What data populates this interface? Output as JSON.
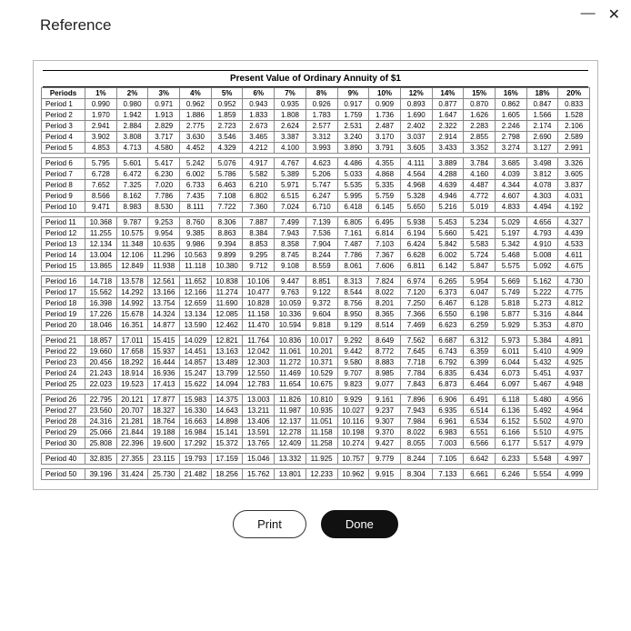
{
  "window": {
    "title": "Reference",
    "minimize": "—",
    "close": "✕"
  },
  "buttons": {
    "print": "Print",
    "done": "Done"
  },
  "table": {
    "caption": "Present Value of Ordinary Annuity of $1",
    "corner": "Periods",
    "rates": [
      "1%",
      "2%",
      "3%",
      "4%",
      "5%",
      "6%",
      "7%",
      "8%",
      "9%",
      "10%",
      "12%",
      "14%",
      "15%",
      "16%",
      "18%",
      "20%"
    ],
    "groups": [
      [
        {
          "label": "Period 1",
          "vals": [
            "0.990",
            "0.980",
            "0.971",
            "0.962",
            "0.952",
            "0.943",
            "0.935",
            "0.926",
            "0.917",
            "0.909",
            "0.893",
            "0.877",
            "0.870",
            "0.862",
            "0.847",
            "0.833"
          ]
        },
        {
          "label": "Period 2",
          "vals": [
            "1.970",
            "1.942",
            "1.913",
            "1.886",
            "1.859",
            "1.833",
            "1.808",
            "1.783",
            "1.759",
            "1.736",
            "1.690",
            "1.647",
            "1.626",
            "1.605",
            "1.566",
            "1.528"
          ]
        },
        {
          "label": "Period 3",
          "vals": [
            "2.941",
            "2.884",
            "2.829",
            "2.775",
            "2.723",
            "2.673",
            "2.624",
            "2.577",
            "2.531",
            "2.487",
            "2.402",
            "2.322",
            "2.283",
            "2.246",
            "2.174",
            "2.106"
          ]
        },
        {
          "label": "Period 4",
          "vals": [
            "3.902",
            "3.808",
            "3.717",
            "3.630",
            "3.546",
            "3.465",
            "3.387",
            "3.312",
            "3.240",
            "3.170",
            "3.037",
            "2.914",
            "2.855",
            "2.798",
            "2.690",
            "2.589"
          ]
        },
        {
          "label": "Period 5",
          "vals": [
            "4.853",
            "4.713",
            "4.580",
            "4.452",
            "4.329",
            "4.212",
            "4.100",
            "3.993",
            "3.890",
            "3.791",
            "3.605",
            "3.433",
            "3.352",
            "3.274",
            "3.127",
            "2.991"
          ]
        }
      ],
      [
        {
          "label": "Period 6",
          "vals": [
            "5.795",
            "5.601",
            "5.417",
            "5.242",
            "5.076",
            "4.917",
            "4.767",
            "4.623",
            "4.486",
            "4.355",
            "4.111",
            "3.889",
            "3.784",
            "3.685",
            "3.498",
            "3.326"
          ]
        },
        {
          "label": "Period 7",
          "vals": [
            "6.728",
            "6.472",
            "6.230",
            "6.002",
            "5.786",
            "5.582",
            "5.389",
            "5.206",
            "5.033",
            "4.868",
            "4.564",
            "4.288",
            "4.160",
            "4.039",
            "3.812",
            "3.605"
          ]
        },
        {
          "label": "Period 8",
          "vals": [
            "7.652",
            "7.325",
            "7.020",
            "6.733",
            "6.463",
            "6.210",
            "5.971",
            "5.747",
            "5.535",
            "5.335",
            "4.968",
            "4.639",
            "4.487",
            "4.344",
            "4.078",
            "3.837"
          ]
        },
        {
          "label": "Period 9",
          "vals": [
            "8.566",
            "8.162",
            "7.786",
            "7.435",
            "7.108",
            "6.802",
            "6.515",
            "6.247",
            "5.995",
            "5.759",
            "5.328",
            "4.946",
            "4.772",
            "4.607",
            "4.303",
            "4.031"
          ]
        },
        {
          "label": "Period 10",
          "vals": [
            "9.471",
            "8.983",
            "8.530",
            "8.111",
            "7.722",
            "7.360",
            "7.024",
            "6.710",
            "6.418",
            "6.145",
            "5.650",
            "5.216",
            "5.019",
            "4.833",
            "4.494",
            "4.192"
          ]
        }
      ],
      [
        {
          "label": "Period 11",
          "vals": [
            "10.368",
            "9.787",
            "9.253",
            "8.760",
            "8.306",
            "7.887",
            "7.499",
            "7.139",
            "6.805",
            "6.495",
            "5.938",
            "5.453",
            "5.234",
            "5.029",
            "4.656",
            "4.327"
          ]
        },
        {
          "label": "Period 12",
          "vals": [
            "11.255",
            "10.575",
            "9.954",
            "9.385",
            "8.863",
            "8.384",
            "7.943",
            "7.536",
            "7.161",
            "6.814",
            "6.194",
            "5.660",
            "5.421",
            "5.197",
            "4.793",
            "4.439"
          ]
        },
        {
          "label": "Period 13",
          "vals": [
            "12.134",
            "11.348",
            "10.635",
            "9.986",
            "9.394",
            "8.853",
            "8.358",
            "7.904",
            "7.487",
            "7.103",
            "6.424",
            "5.842",
            "5.583",
            "5.342",
            "4.910",
            "4.533"
          ]
        },
        {
          "label": "Period 14",
          "vals": [
            "13.004",
            "12.106",
            "11.296",
            "10.563",
            "9.899",
            "9.295",
            "8.745",
            "8.244",
            "7.786",
            "7.367",
            "6.628",
            "6.002",
            "5.724",
            "5.468",
            "5.008",
            "4.611"
          ]
        },
        {
          "label": "Period 15",
          "vals": [
            "13.865",
            "12.849",
            "11.938",
            "11.118",
            "10.380",
            "9.712",
            "9.108",
            "8.559",
            "8.061",
            "7.606",
            "6.811",
            "6.142",
            "5.847",
            "5.575",
            "5.092",
            "4.675"
          ]
        }
      ],
      [
        {
          "label": "Period 16",
          "vals": [
            "14.718",
            "13.578",
            "12.561",
            "11.652",
            "10.838",
            "10.106",
            "9.447",
            "8.851",
            "8.313",
            "7.824",
            "6.974",
            "6.265",
            "5.954",
            "5.669",
            "5.162",
            "4.730"
          ]
        },
        {
          "label": "Period 17",
          "vals": [
            "15.562",
            "14.292",
            "13.166",
            "12.166",
            "11.274",
            "10.477",
            "9.763",
            "9.122",
            "8.544",
            "8.022",
            "7.120",
            "6.373",
            "6.047",
            "5.749",
            "5.222",
            "4.775"
          ]
        },
        {
          "label": "Period 18",
          "vals": [
            "16.398",
            "14.992",
            "13.754",
            "12.659",
            "11.690",
            "10.828",
            "10.059",
            "9.372",
            "8.756",
            "8.201",
            "7.250",
            "6.467",
            "6.128",
            "5.818",
            "5.273",
            "4.812"
          ]
        },
        {
          "label": "Period 19",
          "vals": [
            "17.226",
            "15.678",
            "14.324",
            "13.134",
            "12.085",
            "11.158",
            "10.336",
            "9.604",
            "8.950",
            "8.365",
            "7.366",
            "6.550",
            "6.198",
            "5.877",
            "5.316",
            "4.844"
          ]
        },
        {
          "label": "Period 20",
          "vals": [
            "18.046",
            "16.351",
            "14.877",
            "13.590",
            "12.462",
            "11.470",
            "10.594",
            "9.818",
            "9.129",
            "8.514",
            "7.469",
            "6.623",
            "6.259",
            "5.929",
            "5.353",
            "4.870"
          ]
        }
      ],
      [
        {
          "label": "Period 21",
          "vals": [
            "18.857",
            "17.011",
            "15.415",
            "14.029",
            "12.821",
            "11.764",
            "10.836",
            "10.017",
            "9.292",
            "8.649",
            "7.562",
            "6.687",
            "6.312",
            "5.973",
            "5.384",
            "4.891"
          ]
        },
        {
          "label": "Period 22",
          "vals": [
            "19.660",
            "17.658",
            "15.937",
            "14.451",
            "13.163",
            "12.042",
            "11.061",
            "10.201",
            "9.442",
            "8.772",
            "7.645",
            "6.743",
            "6.359",
            "6.011",
            "5.410",
            "4.909"
          ]
        },
        {
          "label": "Period 23",
          "vals": [
            "20.456",
            "18.292",
            "16.444",
            "14.857",
            "13.489",
            "12.303",
            "11.272",
            "10.371",
            "9.580",
            "8.883",
            "7.718",
            "6.792",
            "6.399",
            "6.044",
            "5.432",
            "4.925"
          ]
        },
        {
          "label": "Period 24",
          "vals": [
            "21.243",
            "18.914",
            "16.936",
            "15.247",
            "13.799",
            "12.550",
            "11.469",
            "10.529",
            "9.707",
            "8.985",
            "7.784",
            "6.835",
            "6.434",
            "6.073",
            "5.451",
            "4.937"
          ]
        },
        {
          "label": "Period 25",
          "vals": [
            "22.023",
            "19.523",
            "17.413",
            "15.622",
            "14.094",
            "12.783",
            "11.654",
            "10.675",
            "9.823",
            "9.077",
            "7.843",
            "6.873",
            "6.464",
            "6.097",
            "5.467",
            "4.948"
          ]
        }
      ],
      [
        {
          "label": "Period 26",
          "vals": [
            "22.795",
            "20.121",
            "17.877",
            "15.983",
            "14.375",
            "13.003",
            "11.826",
            "10.810",
            "9.929",
            "9.161",
            "7.896",
            "6.906",
            "6.491",
            "6.118",
            "5.480",
            "4.956"
          ]
        },
        {
          "label": "Period 27",
          "vals": [
            "23.560",
            "20.707",
            "18.327",
            "16.330",
            "14.643",
            "13.211",
            "11.987",
            "10.935",
            "10.027",
            "9.237",
            "7.943",
            "6.935",
            "6.514",
            "6.136",
            "5.492",
            "4.964"
          ]
        },
        {
          "label": "Period 28",
          "vals": [
            "24.316",
            "21.281",
            "18.764",
            "16.663",
            "14.898",
            "13.406",
            "12.137",
            "11.051",
            "10.116",
            "9.307",
            "7.984",
            "6.961",
            "6.534",
            "6.152",
            "5.502",
            "4.970"
          ]
        },
        {
          "label": "Period 29",
          "vals": [
            "25.066",
            "21.844",
            "19.188",
            "16.984",
            "15.141",
            "13.591",
            "12.278",
            "11.158",
            "10.198",
            "9.370",
            "8.022",
            "6.983",
            "6.551",
            "6.166",
            "5.510",
            "4.975"
          ]
        },
        {
          "label": "Period 30",
          "vals": [
            "25.808",
            "22.396",
            "19.600",
            "17.292",
            "15.372",
            "13.765",
            "12.409",
            "11.258",
            "10.274",
            "9.427",
            "8.055",
            "7.003",
            "6.566",
            "6.177",
            "5.517",
            "4.979"
          ]
        }
      ],
      [
        {
          "label": "Period 40",
          "vals": [
            "32.835",
            "27.355",
            "23.115",
            "19.793",
            "17.159",
            "15.046",
            "13.332",
            "11.925",
            "10.757",
            "9.779",
            "8.244",
            "7.105",
            "6.642",
            "6.233",
            "5.548",
            "4.997"
          ]
        }
      ],
      [
        {
          "label": "Period 50",
          "vals": [
            "39.196",
            "31.424",
            "25.730",
            "21.482",
            "18.256",
            "15.762",
            "13.801",
            "12.233",
            "10.962",
            "9.915",
            "8.304",
            "7.133",
            "6.661",
            "6.246",
            "5.554",
            "4.999"
          ]
        }
      ]
    ]
  }
}
